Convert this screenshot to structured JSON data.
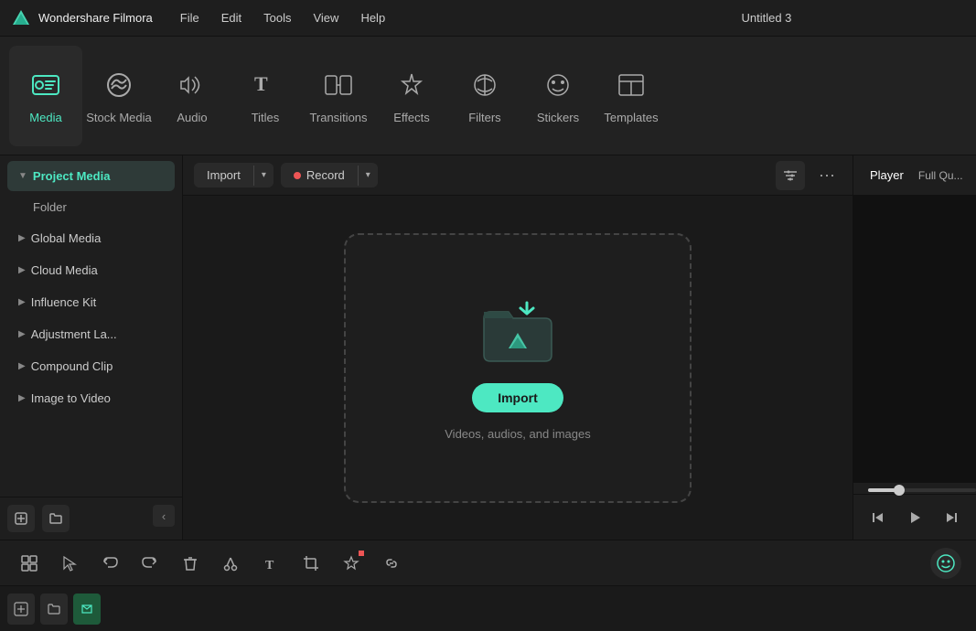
{
  "app": {
    "name": "Wondershare Filmora",
    "title": "Untitled 3"
  },
  "menu": {
    "items": [
      "File",
      "Edit",
      "Tools",
      "View",
      "Help"
    ]
  },
  "toolbar": {
    "items": [
      {
        "id": "media",
        "label": "Media",
        "active": true
      },
      {
        "id": "stock-media",
        "label": "Stock Media",
        "active": false
      },
      {
        "id": "audio",
        "label": "Audio",
        "active": false
      },
      {
        "id": "titles",
        "label": "Titles",
        "active": false
      },
      {
        "id": "transitions",
        "label": "Transitions",
        "active": false
      },
      {
        "id": "effects",
        "label": "Effects",
        "active": false
      },
      {
        "id": "filters",
        "label": "Filters",
        "active": false
      },
      {
        "id": "stickers",
        "label": "Stickers",
        "active": false
      },
      {
        "id": "templates",
        "label": "Templates",
        "active": false
      }
    ]
  },
  "sidebar": {
    "items": [
      {
        "id": "project-media",
        "label": "Project Media",
        "active": true,
        "hasArrow": true,
        "expanded": true
      },
      {
        "id": "folder",
        "label": "Folder",
        "active": false,
        "sub": true
      },
      {
        "id": "global-media",
        "label": "Global Media",
        "active": false,
        "hasArrow": true
      },
      {
        "id": "cloud-media",
        "label": "Cloud Media",
        "active": false,
        "hasArrow": true
      },
      {
        "id": "influence-kit",
        "label": "Influence Kit",
        "active": false,
        "hasArrow": true
      },
      {
        "id": "adjustment-layer",
        "label": "Adjustment La...",
        "active": false,
        "hasArrow": true
      },
      {
        "id": "compound-clip",
        "label": "Compound Clip",
        "active": false,
        "hasArrow": true
      },
      {
        "id": "image-to-video",
        "label": "Image to Video",
        "active": false,
        "hasArrow": true
      }
    ],
    "bottom_buttons": [
      {
        "id": "add-media",
        "icon": "+"
      },
      {
        "id": "add-folder",
        "icon": "📁"
      },
      {
        "id": "collapse",
        "icon": "‹"
      }
    ]
  },
  "media_toolbar": {
    "import_label": "Import",
    "record_label": "Record",
    "filter_icon": "filter",
    "more_icon": "more"
  },
  "drop_zone": {
    "import_btn_label": "Import",
    "subtitle": "Videos, audios, and images"
  },
  "player": {
    "tab_label": "Player",
    "tab_more": "Full Qu..."
  },
  "bottom_toolbar": {
    "buttons": [
      {
        "id": "grid-btn",
        "icon": "grid"
      },
      {
        "id": "cursor-btn",
        "icon": "cursor"
      },
      {
        "id": "undo-btn",
        "icon": "undo"
      },
      {
        "id": "redo-btn",
        "icon": "redo"
      },
      {
        "id": "delete-btn",
        "icon": "delete"
      },
      {
        "id": "cut-btn",
        "icon": "cut"
      },
      {
        "id": "text-btn",
        "icon": "text"
      },
      {
        "id": "crop-btn",
        "icon": "crop"
      },
      {
        "id": "ai-btn",
        "icon": "ai"
      },
      {
        "id": "link-btn",
        "icon": "link"
      }
    ],
    "right_icon": "face"
  }
}
